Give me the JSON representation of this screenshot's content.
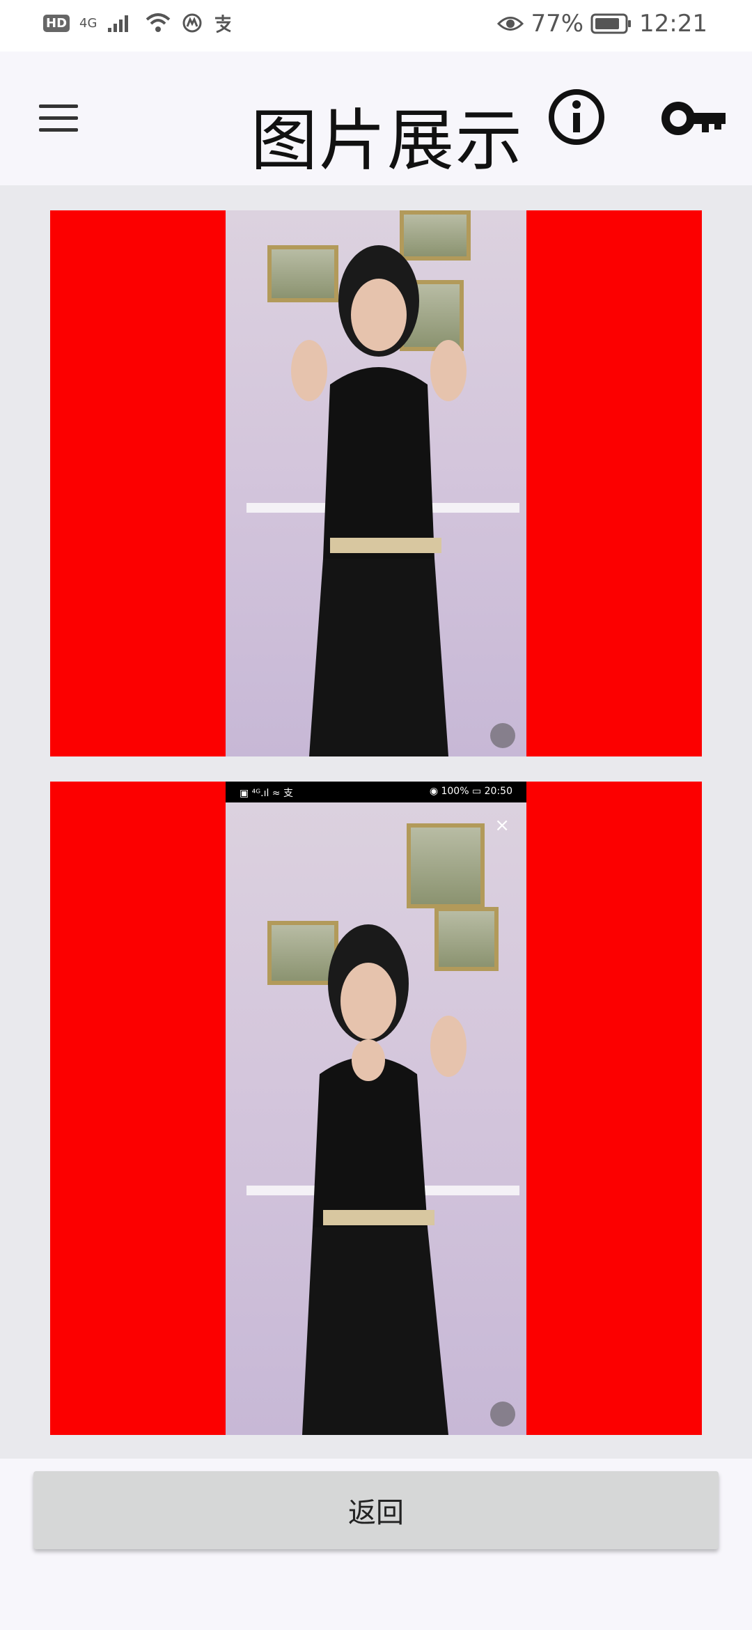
{
  "status_bar": {
    "hd_badge": "HD",
    "network": "4G",
    "carrier_icon": "signal-icon",
    "battery": "77%",
    "time": "12:21"
  },
  "toolbar": {
    "title": "图片展示",
    "menu_icon": "menu-icon",
    "info_icon": "info-icon",
    "key_icon": "key-icon"
  },
  "images": [
    {
      "background": "#fc0000"
    },
    {
      "background": "#fc0000",
      "inner_status_left": "▣ ⁴ᴳ.ıl ≈ 支",
      "inner_status_right": "◉ 100% ▭ 20:50",
      "close_glyph": "×"
    }
  ],
  "footer": {
    "back_label": "返回"
  }
}
